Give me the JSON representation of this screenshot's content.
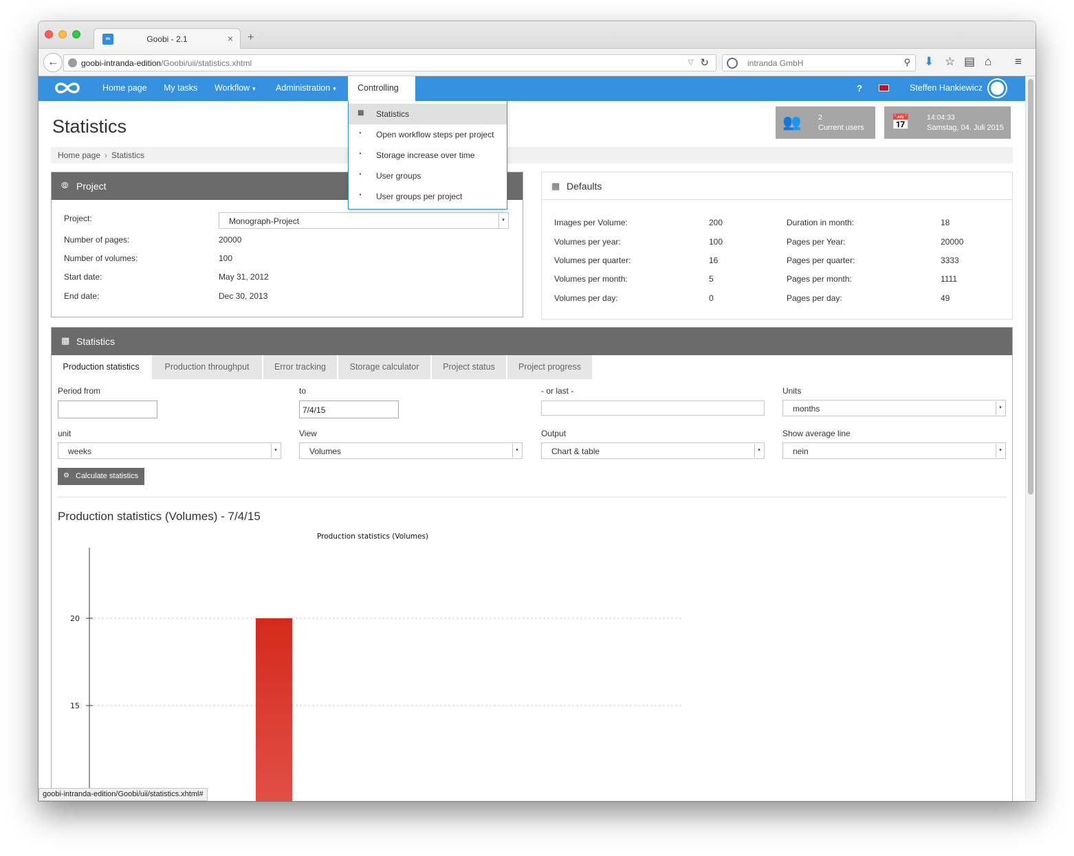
{
  "browser": {
    "tab_title": "Goobi - 2.1",
    "url_host": "goobi-intranda-edition",
    "url_path": "/Goobi/uii/statistics.xhtml",
    "search_engine_text": "intranda GmbH",
    "status_url": "goobi-intranda-edition/Goobi/uii/statistics.xhtml#"
  },
  "navbar": {
    "items": [
      "Home page",
      "My tasks",
      "Workflow",
      "Administration",
      "Controlling"
    ],
    "help": "?",
    "user": "Steffen Hankiewicz"
  },
  "controlling_menu": {
    "items": [
      "Statistics",
      "Open workflow steps per project",
      "Storage increase over time",
      "User groups",
      "User groups per project"
    ]
  },
  "page": {
    "title": "Statistics",
    "breadcrumb": [
      "Home page",
      "Statistics"
    ]
  },
  "info_boxes": {
    "users_count": "2",
    "users_label": "Current users",
    "time": "14:04:33",
    "date": "Samstag, 04. Juli 2015"
  },
  "project_panel": {
    "title": "Project",
    "rows": [
      {
        "label": "Project:",
        "value": "Monograph-Project"
      },
      {
        "label": "Number of pages:",
        "value": "20000"
      },
      {
        "label": "Number of volumes:",
        "value": "100"
      },
      {
        "label": "Start date:",
        "value": "May 31, 2012"
      },
      {
        "label": "End date:",
        "value": "Dec 30, 2013"
      }
    ]
  },
  "defaults_panel": {
    "title": "Defaults",
    "left": [
      {
        "label": "Images per Volume:",
        "value": "200"
      },
      {
        "label": "Volumes per year:",
        "value": "100"
      },
      {
        "label": "Volumes per quarter:",
        "value": "16"
      },
      {
        "label": "Volumes per month:",
        "value": "5"
      },
      {
        "label": "Volumes per day:",
        "value": "0"
      }
    ],
    "right": [
      {
        "label": "Duration in month:",
        "value": "18"
      },
      {
        "label": "Pages per Year:",
        "value": "20000"
      },
      {
        "label": "Pages per quarter:",
        "value": "3333"
      },
      {
        "label": "Pages per month:",
        "value": "1111"
      },
      {
        "label": "Pages per day:",
        "value": "49"
      }
    ]
  },
  "statistics_panel": {
    "title": "Statistics",
    "tabs": [
      "Production statistics",
      "Production throughput",
      "Error tracking",
      "Storage calculator",
      "Project status",
      "Project progress"
    ],
    "form": {
      "period_from_label": "Period from",
      "period_from_value": "",
      "to_label": "to",
      "to_value": "7/4/15",
      "or_last_label": "- or last -",
      "or_last_value": "",
      "units_label": "Units",
      "units_value": "months",
      "unit_label": "unit",
      "unit_value": "weeks",
      "view_label": "View",
      "view_value": "Volumes",
      "output_label": "Output",
      "output_value": "Chart & table",
      "avg_label": "Show average line",
      "avg_value": "nein"
    },
    "calc_button": "Calculate statistics",
    "result_title": "Production statistics (Volumes) - 7/4/15"
  },
  "colors": {
    "navbar": "#3590e0",
    "panel_header": "#6b6b6b",
    "bar": "#d42a1c"
  },
  "chart_data": {
    "type": "bar",
    "title": "Production statistics (Volumes)",
    "yticks": [
      15,
      20
    ],
    "series": [
      {
        "values": [
          20
        ]
      }
    ]
  }
}
